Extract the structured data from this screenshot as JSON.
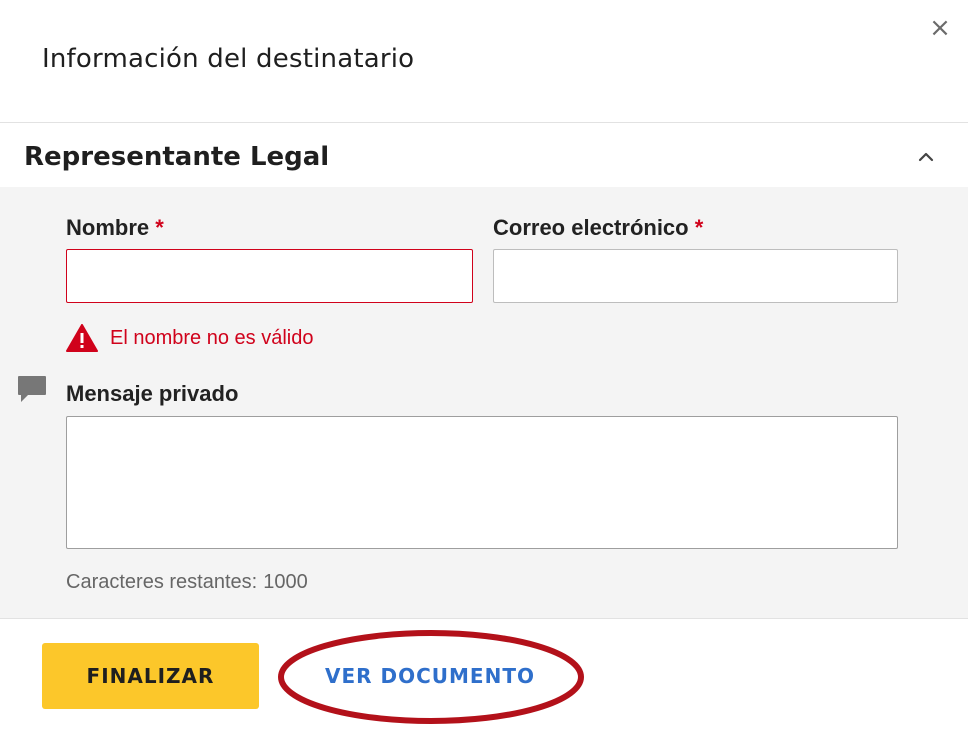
{
  "modal": {
    "title": "Información del destinatario",
    "close_glyph": "×"
  },
  "section": {
    "title": "Representante Legal",
    "expanded": true
  },
  "form": {
    "name": {
      "label": "Nombre",
      "required_marker": "*",
      "value": "",
      "error": "El nombre no es válido"
    },
    "email": {
      "label": "Correo electrónico",
      "required_marker": "*",
      "value": ""
    },
    "private_message": {
      "label": "Mensaje privado",
      "value": "",
      "remaining_label": "Caracteres restantes:",
      "remaining_count": "1000"
    }
  },
  "footer": {
    "finish_label": "FINALIZAR",
    "view_document_label": "VER DOCUMENTO"
  },
  "icons": {
    "close": "close-icon",
    "collapse": "chevron-up-icon",
    "error": "warning-triangle-icon",
    "message": "comment-icon"
  },
  "colors": {
    "accent_yellow": "#fcc72a",
    "link_blue": "#2f6fcb",
    "error_red": "#d0021b",
    "annotation_red": "#b3111a",
    "section_bg": "#f4f4f4"
  },
  "annotation": {
    "shape": "ellipse",
    "target": "view-document-button"
  }
}
